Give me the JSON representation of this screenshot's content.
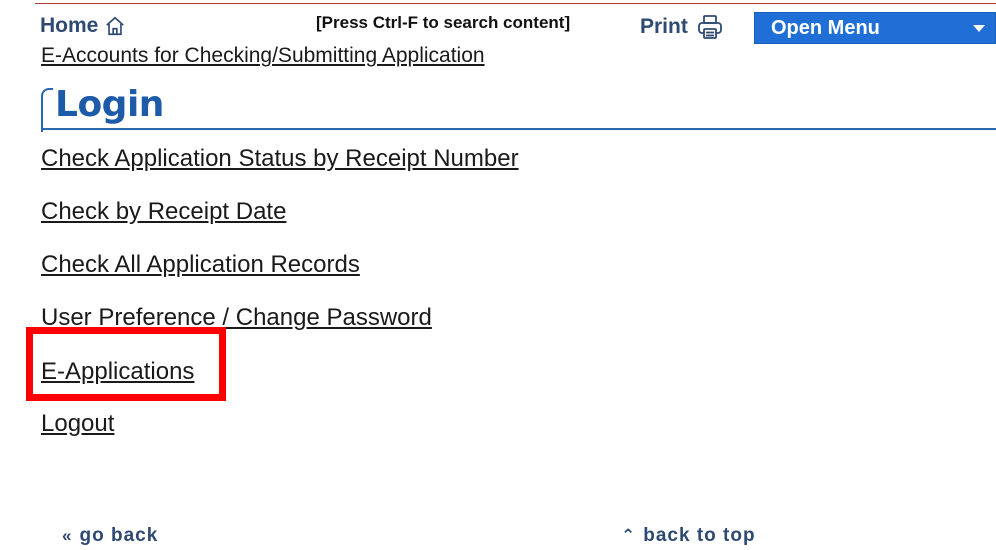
{
  "header": {
    "home_label": "Home",
    "search_hint": "[Press Ctrl-F to search content]",
    "print_label": "Print",
    "open_menu_label": "Open Menu",
    "menu_color": "#1f6fd6",
    "link_color": "#2e4a73"
  },
  "breadcrumb": {
    "eaccounts_label": "E-Accounts for Checking/Submitting Application"
  },
  "section": {
    "title": "Login",
    "title_color": "#1d5aa8"
  },
  "menu": {
    "items": [
      {
        "label": "Check Application Status by Receipt Number"
      },
      {
        "label": "Check by Receipt Date"
      },
      {
        "label": "Check All Application Records"
      },
      {
        "label": "User Preference / Change Password"
      },
      {
        "label": "E-Applications",
        "highlighted": true,
        "highlight_color": "#ff0000"
      },
      {
        "label": "Logout"
      }
    ]
  },
  "footer": {
    "go_back_label": "go back",
    "go_back_icon": "double-chevron-left-icon",
    "back_to_top_label": "back to top",
    "back_to_top_icon": "double-chevron-up-icon"
  }
}
